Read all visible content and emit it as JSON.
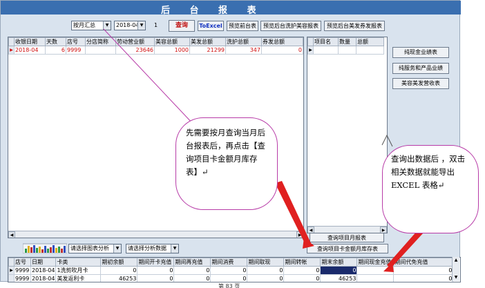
{
  "window": {
    "title": "后 台 报 表"
  },
  "toolbar": {
    "mode_select": "按月汇总",
    "month_select": "2018-04",
    "page_number": "1",
    "query_button": "查询",
    "excel_button": "ToExcel",
    "preview_front": "预览前台表",
    "preview_beauty": "预览后台洗护美容报表",
    "preview_hair": "预览后台美发券发报表"
  },
  "main_table": {
    "columns": [
      "收银日期",
      "天数",
      "店号",
      "分店简称",
      "劳动营业额",
      "美容总额",
      "美发总额",
      "洗护总额",
      "券发总额"
    ],
    "rows": [
      [
        "2018-04",
        "6",
        "9999",
        "",
        "23646",
        "1000",
        "21299",
        "347",
        "0"
      ]
    ]
  },
  "item_table": {
    "columns": [
      "项目名",
      "数量",
      "总额"
    ]
  },
  "side_buttons": [
    "纯现金业绩表",
    "纯服务和产品业绩",
    "美容美发营收表"
  ],
  "bottom_controls": {
    "chart_select": "请选择图表分析",
    "data_select": "请选择分析数据",
    "query_item_month": "查询项目月报表",
    "query_card_month": "查询项目卡金额月库存表"
  },
  "bottom_table": {
    "columns": [
      "店号",
      "日期",
      "卡类",
      "期初余额",
      "期间开卡充值",
      "期间再充值",
      "期间消费",
      "期间取现",
      "期间转帐",
      "期末余额",
      "期间现金充值",
      "期间代免充值"
    ],
    "rows": [
      [
        "9999",
        "2018-04",
        "1洗剪吹月卡",
        "0",
        "0",
        "0",
        "0",
        "0",
        "0",
        "0",
        "",
        "0"
      ],
      [
        "9999",
        "2018-04",
        "美发返利卡",
        "46253",
        "0",
        "0",
        "0",
        "0",
        "0",
        "46253",
        "",
        "0"
      ]
    ]
  },
  "callouts": {
    "left": "先需要按月查询当月后台报表后，再点击【查询项目卡金额月库存表】↵",
    "right": "查询出数据后 ，双击相关数据就能导出 EXCEL 表格↵"
  },
  "footer_text": "第 83 页",
  "colors": {
    "title_bar": "#3a6fb0",
    "annotation_border": "#b73aa7",
    "arrow": "#e02020",
    "selected_cell": "#1a2a6c"
  }
}
